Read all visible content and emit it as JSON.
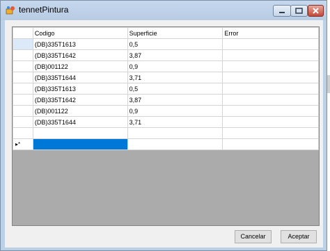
{
  "window": {
    "title": "tennetPintura"
  },
  "grid": {
    "columns": [
      "Codigo",
      "Superficie",
      "Error"
    ],
    "rows": [
      [
        "(DB)335T1613",
        "0,5",
        ""
      ],
      [
        "(DB)335T1642",
        "3,87",
        ""
      ],
      [
        "(DB)001122",
        "0,9",
        ""
      ],
      [
        "(DB)335T1644",
        "3,71",
        ""
      ],
      [
        "(DB)335T1613",
        "0,5",
        ""
      ],
      [
        "(DB)335T1642",
        "3,87",
        ""
      ],
      [
        "(DB)001122",
        "0,9",
        ""
      ],
      [
        "(DB)335T1644",
        "3,71",
        ""
      ],
      [
        "",
        "",
        ""
      ]
    ],
    "new_row_marker": "▸*"
  },
  "buttons": {
    "cancel": "Cancelar",
    "accept": "Aceptar"
  },
  "icons": {
    "app": "paint-app-icon",
    "minimize": "minimize-icon",
    "maximize": "maximize-icon",
    "close": "close-icon"
  },
  "colors": {
    "selection": "#0078d7",
    "titlebar": "#c6d8ee",
    "close_button": "#c4493a"
  }
}
